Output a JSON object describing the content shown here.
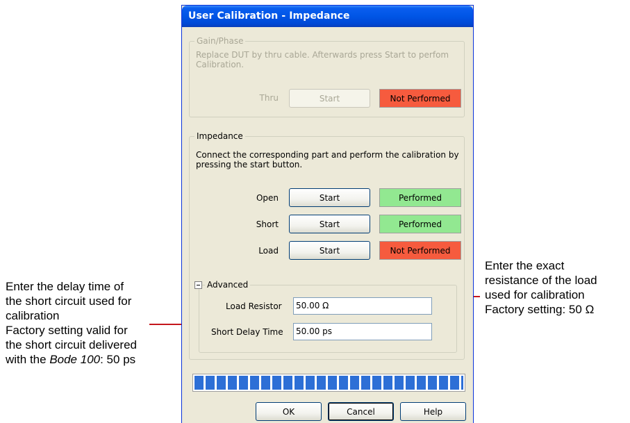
{
  "window": {
    "title": "User Calibration - Impedance"
  },
  "gain_phase": {
    "legend": "Gain/Phase",
    "description": "Replace DUT by thru cable. Afterwards press Start to perfom Calibration.",
    "row": {
      "label": "Thru",
      "button": "Start",
      "status": "Not Performed",
      "status_color": "#f65b3e"
    }
  },
  "impedance": {
    "legend": "Impedance",
    "description": "Connect the corresponding part and perform the calibration by pressing the start button.",
    "rows": [
      {
        "label": "Open",
        "button": "Start",
        "status": "Performed",
        "status_color": "#92e891"
      },
      {
        "label": "Short",
        "button": "Start",
        "status": "Performed",
        "status_color": "#92e891"
      },
      {
        "label": "Load",
        "button": "Start",
        "status": "Not Performed",
        "status_color": "#f65b3e"
      }
    ]
  },
  "advanced": {
    "legend": "Advanced",
    "load_resistor": {
      "label": "Load Resistor",
      "value": "50.00 Ω"
    },
    "short_delay": {
      "label": "Short Delay Time",
      "value": "50.00 ps"
    }
  },
  "progress": {
    "value_percent": 100,
    "color": "#2d6fd6"
  },
  "buttons": {
    "ok": "OK",
    "cancel": "Cancel",
    "help": "Help"
  },
  "annotations": {
    "left": {
      "line1": "Enter the delay time of",
      "line2": "the short circuit used for",
      "line3": "calibration",
      "line4": "Factory setting valid for",
      "line5": "the short circuit delivered",
      "line6_prefix": "with the ",
      "line6_italic": "Bode 100",
      "line6_suffix": ": 50 ps"
    },
    "right": {
      "line1": "Enter the exact",
      "line2": "resistance of the load",
      "line3": "used for calibration",
      "line4": "Factory setting: 50 Ω"
    },
    "leader_color": "#c4161c"
  }
}
